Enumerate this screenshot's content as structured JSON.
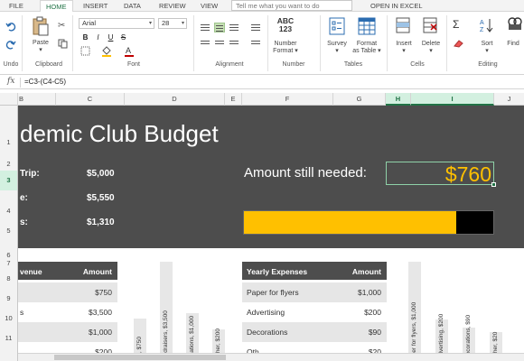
{
  "ribbon_tabs": [
    "FILE",
    "HOME",
    "INSERT",
    "DATA",
    "REVIEW",
    "VIEW"
  ],
  "active_tab": "HOME",
  "tell_me_placeholder": "Tell me what you want to do",
  "open_in_excel": "OPEN IN EXCEL",
  "ribbon": {
    "undo_label": "Undo",
    "clipboard_label": "Clipboard",
    "paste_label": "Paste",
    "font_name": "Arial",
    "font_size": "28",
    "font_label": "Font",
    "alignment_label": "Alignment",
    "number_format_icon": "ABC\n123",
    "number_format_label_1": "Number",
    "number_format_label_2": "Format",
    "number_label": "Number",
    "survey_label": "Survey",
    "format_table_label_1": "Format",
    "format_table_label_2": "as Table",
    "tables_label": "Tables",
    "insert_label": "Insert",
    "delete_label": "Delete",
    "cells_label": "Cells",
    "sort_label": "Sort",
    "find_label": "Find",
    "editing_label": "Editing",
    "format_buttons": [
      "B",
      "I",
      "U",
      "S"
    ]
  },
  "formula_bar": {
    "fx": "fx",
    "formula": "=C3-(C4-C5)"
  },
  "columns": [
    "B",
    "C",
    "D",
    "E",
    "F",
    "G",
    "H",
    "I",
    "J"
  ],
  "selected_columns": [
    "H",
    "I"
  ],
  "rows": [
    "1",
    "2",
    "3",
    "4",
    "5",
    "6",
    "7",
    "8",
    "9",
    "10",
    "11"
  ],
  "selected_row": "3",
  "sheet": {
    "title": "demic Club Budget",
    "summary": [
      {
        "label": "Trip:",
        "value": "$5,000"
      },
      {
        "label": "e:",
        "value": "$5,550"
      },
      {
        "label": "s:",
        "value": "$1,310"
      }
    ],
    "amount_needed_label": "Amount still needed:",
    "amount_needed_value": "$760",
    "progress_fraction": 0.85,
    "accent_color": "#ffc000",
    "banner_color": "#4d4d4d"
  },
  "revenue_table": {
    "headers": [
      "venue",
      "Amount"
    ],
    "rows": [
      {
        "label": "",
        "amount": "$750"
      },
      {
        "label": "s",
        "amount": "$3,500"
      },
      {
        "label": "",
        "amount": "$1,000"
      },
      {
        "label": "",
        "amount": "$200"
      }
    ]
  },
  "revenue_chart_labels": [
    "es, $750",
    "undraisers, $3,500",
    "onations, $1,000",
    "Other, $200"
  ],
  "revenue_chart_values": [
    750,
    3500,
    1000,
    200
  ],
  "expenses_table": {
    "headers": [
      "Yearly Expenses",
      "Amount"
    ],
    "rows": [
      {
        "label": "Paper for flyers",
        "amount": "$1,000"
      },
      {
        "label": "Advertising",
        "amount": "$200"
      },
      {
        "label": "Decorations",
        "amount": "$90"
      },
      {
        "label": "Oth",
        "amount": "$20"
      }
    ]
  },
  "expenses_chart_labels": [
    "aper for flyers, $1,000",
    "Advertising, $200",
    "Decorations, $90",
    "Other, $20"
  ],
  "expenses_chart_values": [
    1000,
    200,
    90,
    20
  ]
}
